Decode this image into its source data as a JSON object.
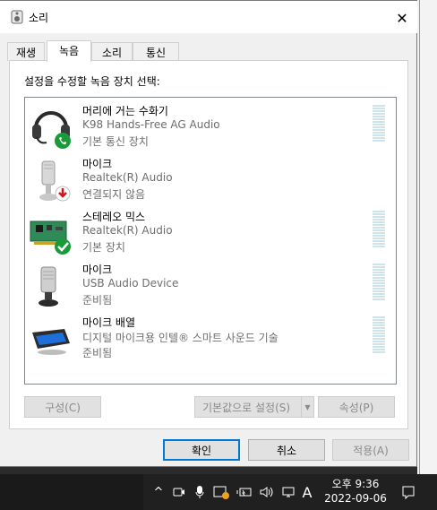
{
  "dialog": {
    "title": "소리",
    "close_glyph": "✕",
    "tabs": [
      {
        "label": "재생"
      },
      {
        "label": "녹음"
      },
      {
        "label": "소리"
      },
      {
        "label": "통신"
      }
    ],
    "active_tab": "녹음",
    "instruction": "설정을 수정할 녹음 장치 선택:",
    "devices": [
      {
        "name": "머리에 거는 수화기",
        "driver": "K98 Hands-Free AG Audio",
        "status": "기본 통신 장치",
        "icon": "headset-icon",
        "badge": "phone-badge-icon"
      },
      {
        "name": "마이크",
        "driver": "Realtek(R) Audio",
        "status": "연결되지 않음",
        "icon": "microphone-icon",
        "badge": "disconnected-badge-icon"
      },
      {
        "name": "스테레오 믹스",
        "driver": "Realtek(R) Audio",
        "status": "기본 장치",
        "icon": "sound-card-icon",
        "badge": "default-check-badge-icon"
      },
      {
        "name": "마이크",
        "driver": "USB Audio Device",
        "status": "준비됨",
        "icon": "usb-microphone-icon",
        "badge": ""
      },
      {
        "name": "마이크 배열",
        "driver": "디지털 마이크용 인텔® 스마트 사운드 기술",
        "status": "준비됨",
        "icon": "microphone-array-icon",
        "badge": ""
      }
    ],
    "buttons": {
      "configure": "구성(C)",
      "set_default": "기본값으로 설정(S)",
      "properties": "속성(P)",
      "ok": "확인",
      "cancel": "취소",
      "apply": "적용(A)"
    }
  },
  "taskbar": {
    "time": "오후 9:36",
    "date": "2022-09-06",
    "ime": "A"
  }
}
